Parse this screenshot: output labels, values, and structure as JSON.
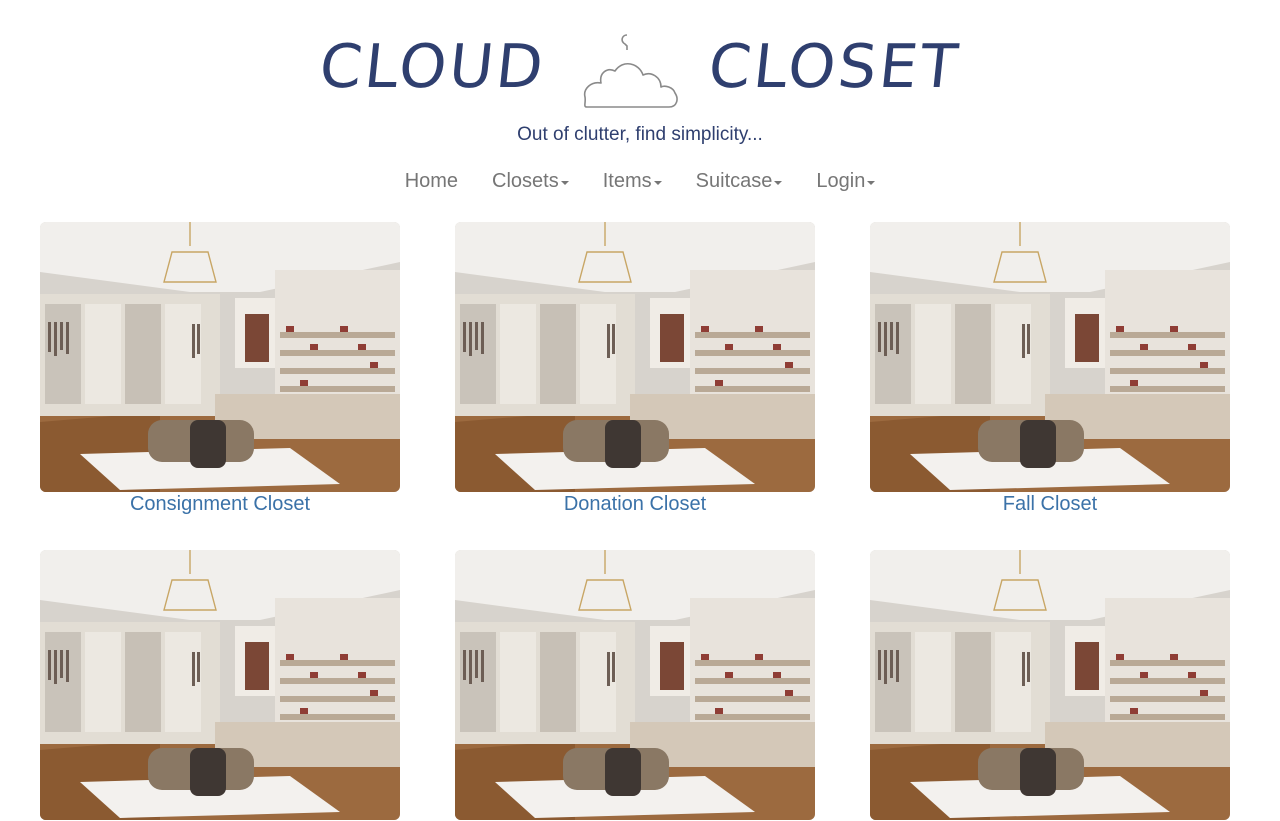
{
  "brand": {
    "word1": "CLOUD",
    "word2": "CLOSET",
    "logo_icon": "cloud-hanger-icon"
  },
  "tagline": "Out of clutter, find simplicity...",
  "nav": [
    {
      "label": "Home",
      "dropdown": false
    },
    {
      "label": "Closets",
      "dropdown": true
    },
    {
      "label": "Items",
      "dropdown": true
    },
    {
      "label": "Suitcase",
      "dropdown": true
    },
    {
      "label": "Login",
      "dropdown": true
    }
  ],
  "closets": [
    {
      "name": "Consignment Closet"
    },
    {
      "name": "Donation Closet"
    },
    {
      "name": "Fall Closet"
    },
    {
      "name": ""
    },
    {
      "name": ""
    },
    {
      "name": ""
    }
  ],
  "colors": {
    "brand": "#2f3f6f",
    "nav_text": "#767676",
    "link": "#3b72a8"
  }
}
